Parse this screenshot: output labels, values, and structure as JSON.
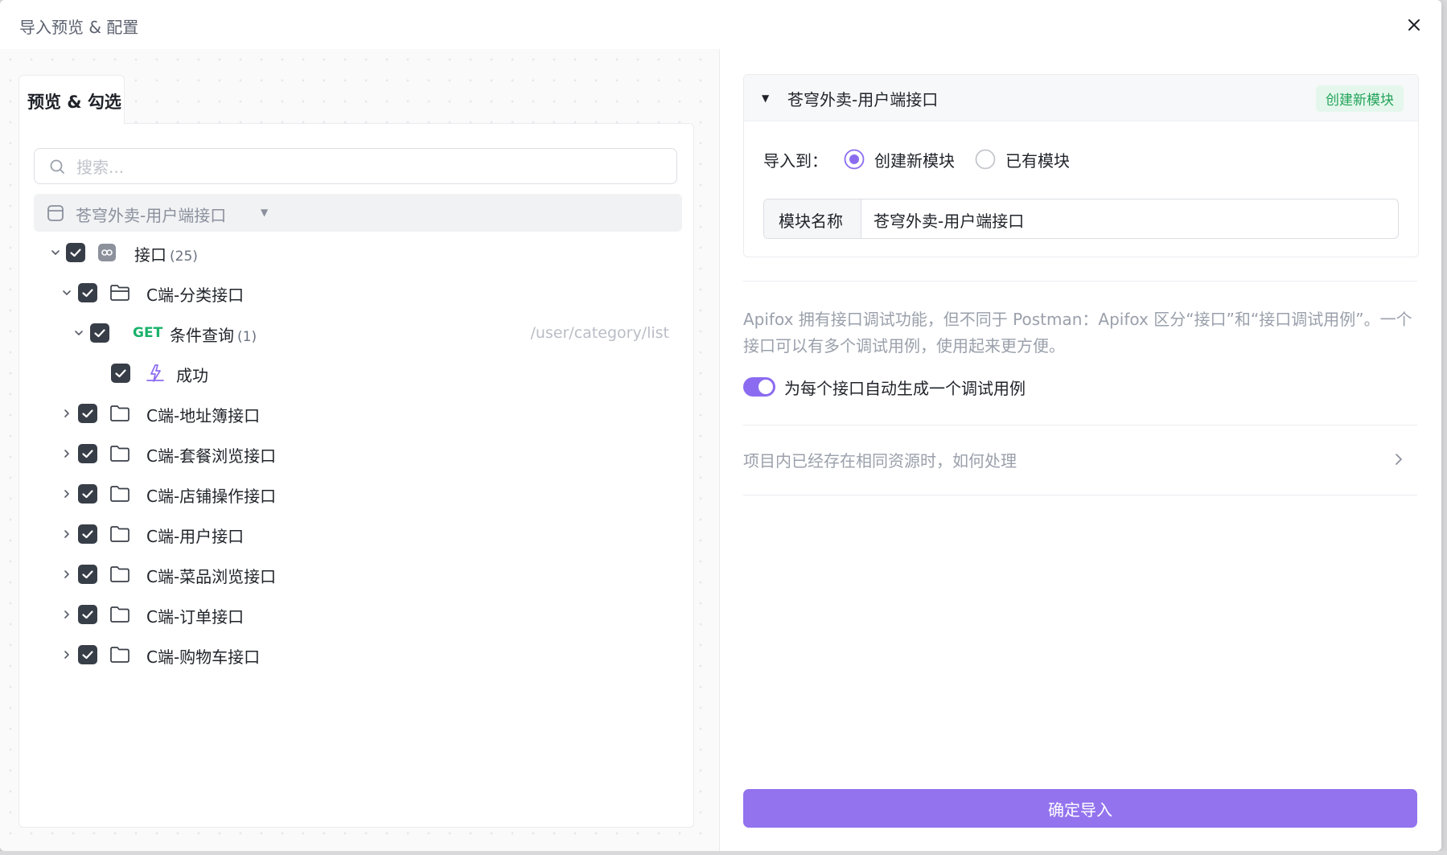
{
  "dialog": {
    "title": "导入预览 & 配置"
  },
  "left": {
    "tab_label": "预览 & 勾选",
    "search_placeholder": "搜索...",
    "project_name": "苍穹外卖-用户端接口",
    "tree": {
      "root": {
        "label": "接口",
        "count": "(25)"
      },
      "folder_expanded": {
        "label": "C端-分类接口"
      },
      "endpoint": {
        "method": "GET",
        "label": "条件查询",
        "count": "(1)",
        "path": "/user/category/list"
      },
      "case": {
        "label": "成功"
      },
      "folders": [
        {
          "label": "C端-地址簿接口"
        },
        {
          "label": "C端-套餐浏览接口"
        },
        {
          "label": "C端-店铺操作接口"
        },
        {
          "label": "C端-用户接口"
        },
        {
          "label": "C端-菜品浏览接口"
        },
        {
          "label": "C端-订单接口"
        },
        {
          "label": "C端-购物车接口"
        }
      ]
    }
  },
  "right": {
    "module_card": {
      "title": "苍穹外卖-用户端接口",
      "badge": "创建新模块",
      "import_to_label": "导入到：",
      "radio_new": "创建新模块",
      "radio_existing": "已有模块",
      "name_label": "模块名称",
      "name_value": "苍穹外卖-用户端接口"
    },
    "description": "Apifox 拥有接口调试功能，但不同于 Postman：Apifox 区分“接口”和“接口调试用例”。一个接口可以有多个调试用例，使用起来更方便。",
    "toggle_label": "为每个接口自动生成一个调试用例",
    "conflict_label": "项目内已经存在相同资源时，如何处理",
    "confirm_button": "确定导入"
  },
  "colors": {
    "accent": "#9373ee",
    "checkbox": "#383e48",
    "get_method": "#17b26a",
    "badge_text": "#22a35a"
  }
}
